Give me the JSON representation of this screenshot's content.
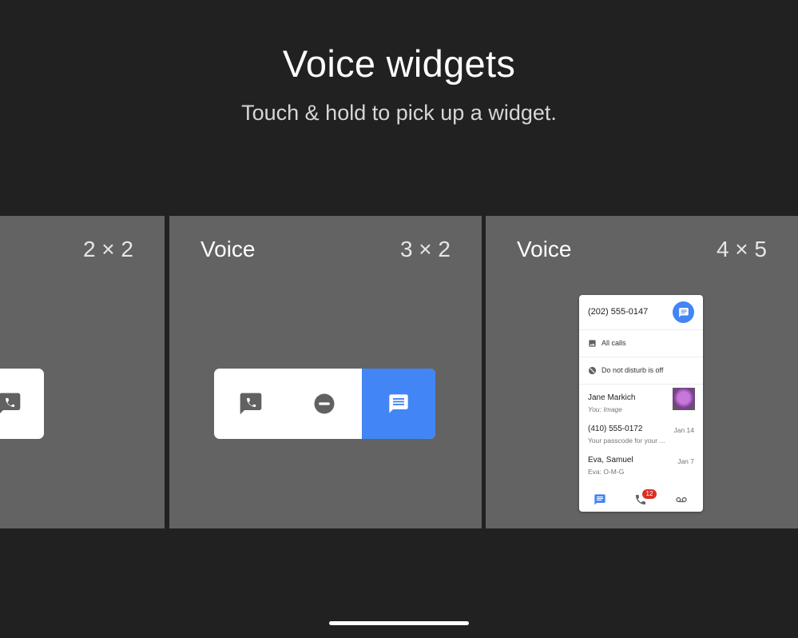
{
  "header": {
    "title": "Voice widgets",
    "subtitle": "Touch & hold to pick up a widget."
  },
  "widgets": [
    {
      "app_name": "",
      "size": "2 × 2"
    },
    {
      "app_name": "Voice",
      "size": "3 × 2"
    },
    {
      "app_name": "Voice",
      "size": "4 × 5"
    }
  ],
  "preview_4x5": {
    "phone_number": "(202) 555-0147",
    "options": [
      "All calls",
      "Do not disturb is off"
    ],
    "conversations": [
      {
        "name": "Jane Markich",
        "preview": "You: Image",
        "date": ""
      },
      {
        "name": "(410) 555-0172",
        "preview": "Your passcode for your ...",
        "date": "Jan 14"
      },
      {
        "name": "Eva, Samuel",
        "preview": "Eva: O-M-G",
        "date": "Jan 7"
      }
    ],
    "missed_calls_badge": "12"
  },
  "colors": {
    "background": "#212121",
    "panel": "#636363",
    "accent": "#4285f4",
    "badge": "#d93025"
  },
  "icons": [
    "phone-icon",
    "do-not-disturb-icon",
    "message-icon",
    "image-icon",
    "voicemail-icon"
  ]
}
